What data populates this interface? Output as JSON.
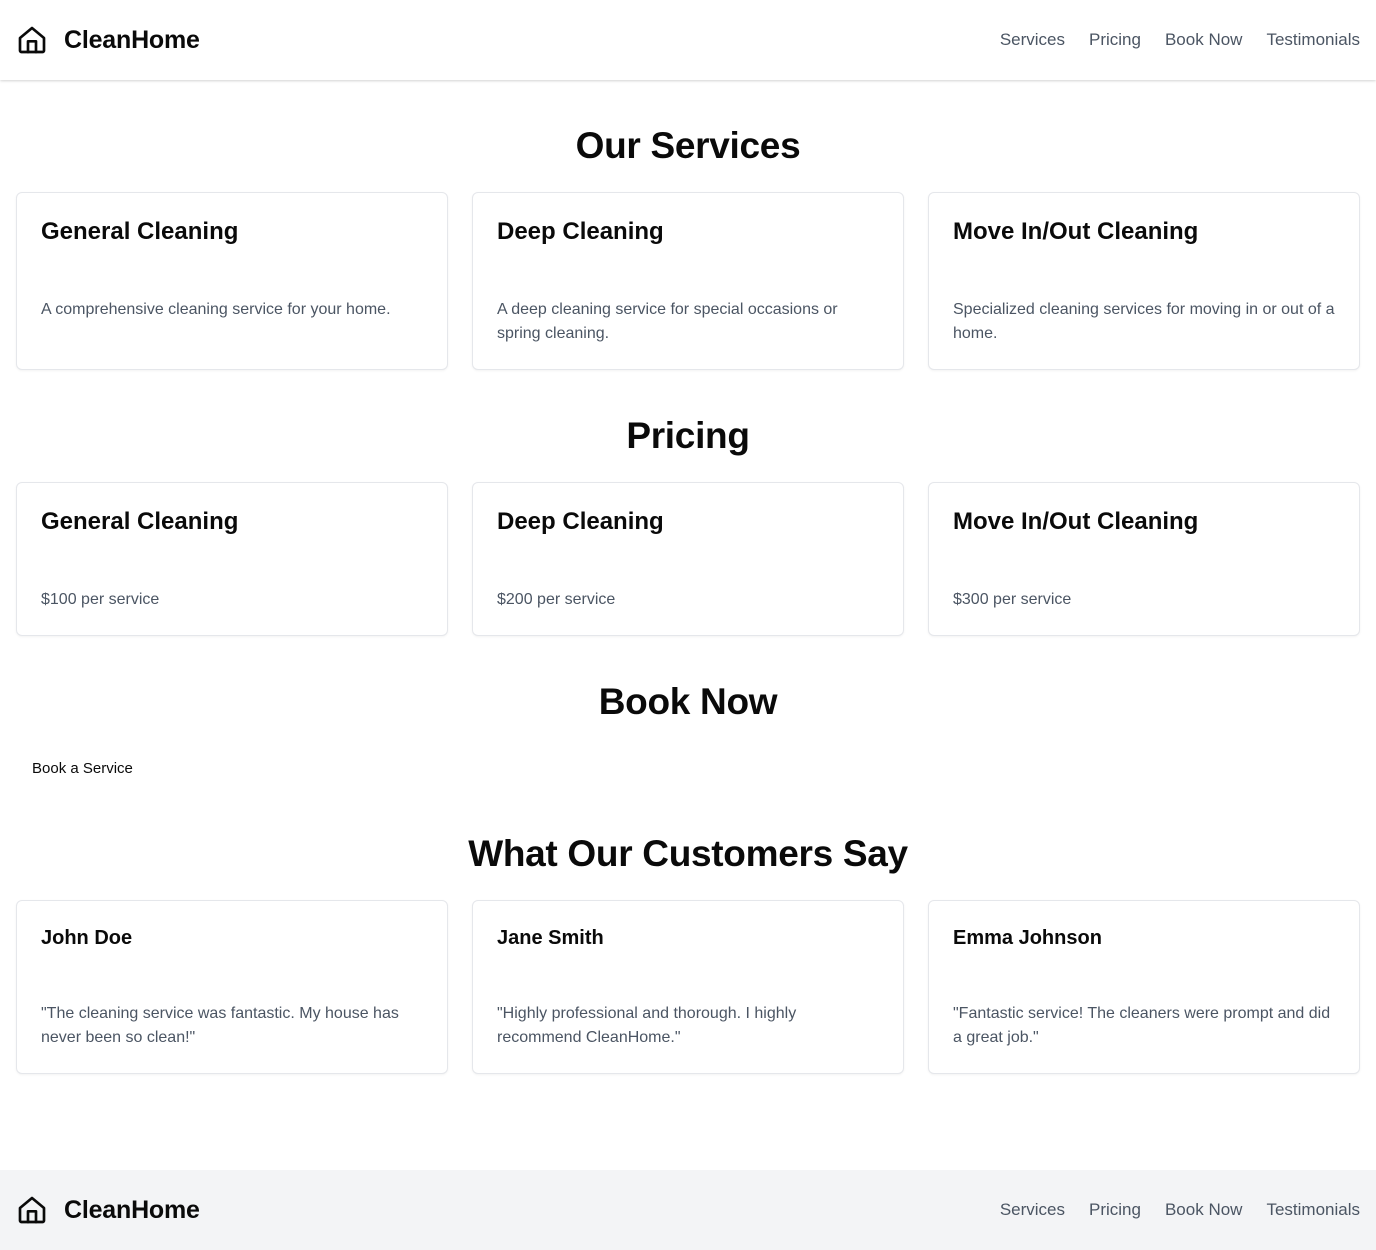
{
  "brand": {
    "name": "CleanHome",
    "icon": "home-icon"
  },
  "nav": [
    "Services",
    "Pricing",
    "Book Now",
    "Testimonials"
  ],
  "services": {
    "title": "Our Services",
    "items": [
      {
        "name": "General Cleaning",
        "description": "A comprehensive cleaning service for your home."
      },
      {
        "name": "Deep Cleaning",
        "description": "A deep cleaning service for special occasions or spring cleaning."
      },
      {
        "name": "Move In/Out Cleaning",
        "description": "Specialized cleaning services for moving in or out of a home."
      }
    ]
  },
  "pricing": {
    "title": "Pricing",
    "items": [
      {
        "name": "General Cleaning",
        "price": "$100 per service"
      },
      {
        "name": "Deep Cleaning",
        "price": "$200 per service"
      },
      {
        "name": "Move In/Out Cleaning",
        "price": "$300 per service"
      }
    ]
  },
  "booking": {
    "title": "Book Now",
    "button_label": "Book a Service"
  },
  "testimonials": {
    "title": "What Our Customers Say",
    "items": [
      {
        "name": "John Doe",
        "quote": "\"The cleaning service was fantastic. My house has never been so clean!\""
      },
      {
        "name": "Jane Smith",
        "quote": "\"Highly professional and thorough. I highly recommend CleanHome.\""
      },
      {
        "name": "Emma Johnson",
        "quote": "\"Fantastic service! The cleaners were prompt and did a great job.\""
      }
    ]
  },
  "footer": {
    "brand_name": "CleanHome",
    "nav": [
      "Services",
      "Pricing",
      "Book Now",
      "Testimonials"
    ]
  },
  "colors": {
    "text": "#0a0a0a",
    "muted": "#4b5563",
    "border": "#e5e7eb",
    "footer_bg": "#f3f4f6"
  }
}
